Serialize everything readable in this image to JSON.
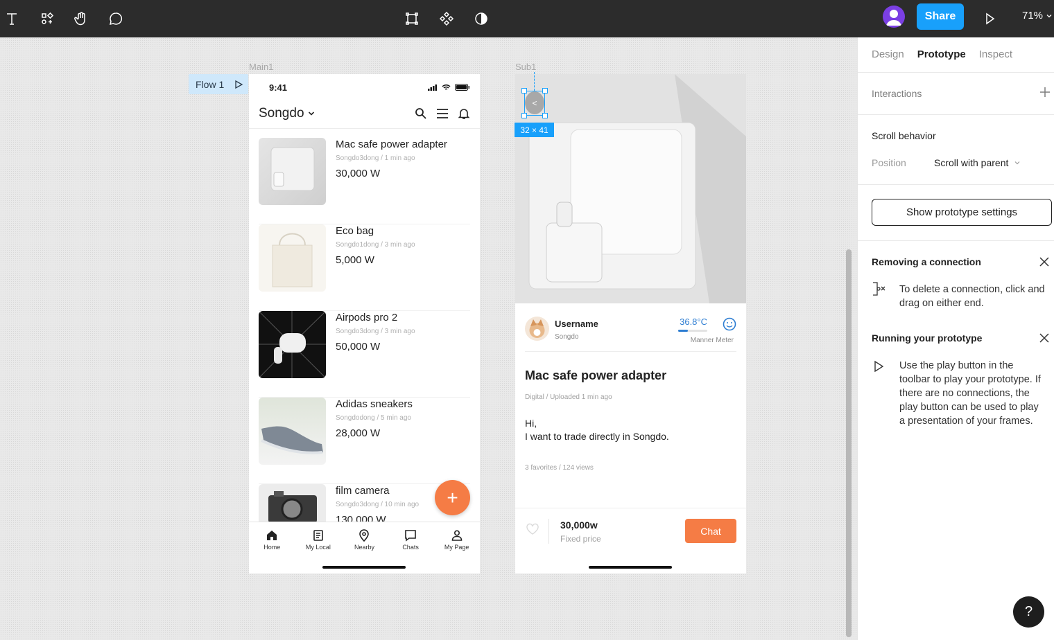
{
  "toolbar": {
    "share_label": "Share",
    "zoom": "71%"
  },
  "canvas": {
    "frame_main_label": "Main1",
    "frame_sub_label": "Sub1",
    "flow_label": "Flow 1",
    "selection_dims": "32 × 41"
  },
  "main": {
    "status_time": "9:41",
    "location": "Songdo",
    "items": [
      {
        "title": "Mac safe power adapter",
        "meta": "Songdo3dong / 1 min ago",
        "price": "30,000 W"
      },
      {
        "title": "Eco bag",
        "meta": "Songdo1dong / 3 min ago",
        "price": "5,000 W"
      },
      {
        "title": "Airpods pro 2",
        "meta": "Songdo3dong / 3 min ago",
        "price": "50,000 W"
      },
      {
        "title": "Adidas sneakers",
        "meta": "Songdodong / 5 min ago",
        "price": "28,000 W"
      },
      {
        "title": "film camera",
        "meta": "Songdo3dong / 10 min ago",
        "price": "130,000 W"
      }
    ],
    "fab_label": "+",
    "tabs": [
      {
        "label": "Home",
        "icon": "home-icon"
      },
      {
        "label": "My Local",
        "icon": "document-icon"
      },
      {
        "label": "Nearby",
        "icon": "pin-icon"
      },
      {
        "label": "Chats",
        "icon": "chat-icon"
      },
      {
        "label": "My Page",
        "icon": "person-icon"
      }
    ]
  },
  "sub": {
    "back_label": "<",
    "username": "Username",
    "user_location": "Songdo",
    "temperature": "36.8°C",
    "temperature_fill": 0.33,
    "manner_label": "Manner Meter",
    "title": "Mac safe power adapter",
    "meta": "Digital / Uploaded 1 min ago",
    "desc_line1": "Hi,",
    "desc_line2": "I want to trade directly in Songdo.",
    "stats": "3 favorites / 124 views",
    "price": "30,000w",
    "price_type": "Fixed price",
    "chat_label": "Chat"
  },
  "panel": {
    "tabs": [
      "Design",
      "Prototype",
      "Inspect"
    ],
    "active_tab": "Prototype",
    "interactions_label": "Interactions",
    "scroll_behavior_label": "Scroll behavior",
    "position_label": "Position",
    "position_value": "Scroll with parent",
    "proto_settings_label": "Show prototype settings",
    "remove_title": "Removing a connection",
    "remove_body": "To delete a connection, click and drag on either end.",
    "run_title": "Running your prototype",
    "run_body": "Use the play button in the toolbar to play your prototype. If there are no connections, the play button can be used to play a presentation of your frames.",
    "help_label": "?"
  },
  "colors": {
    "accent": "#18a0fb",
    "orange": "#f57c45",
    "toolbar_bg": "#2c2c2c"
  }
}
